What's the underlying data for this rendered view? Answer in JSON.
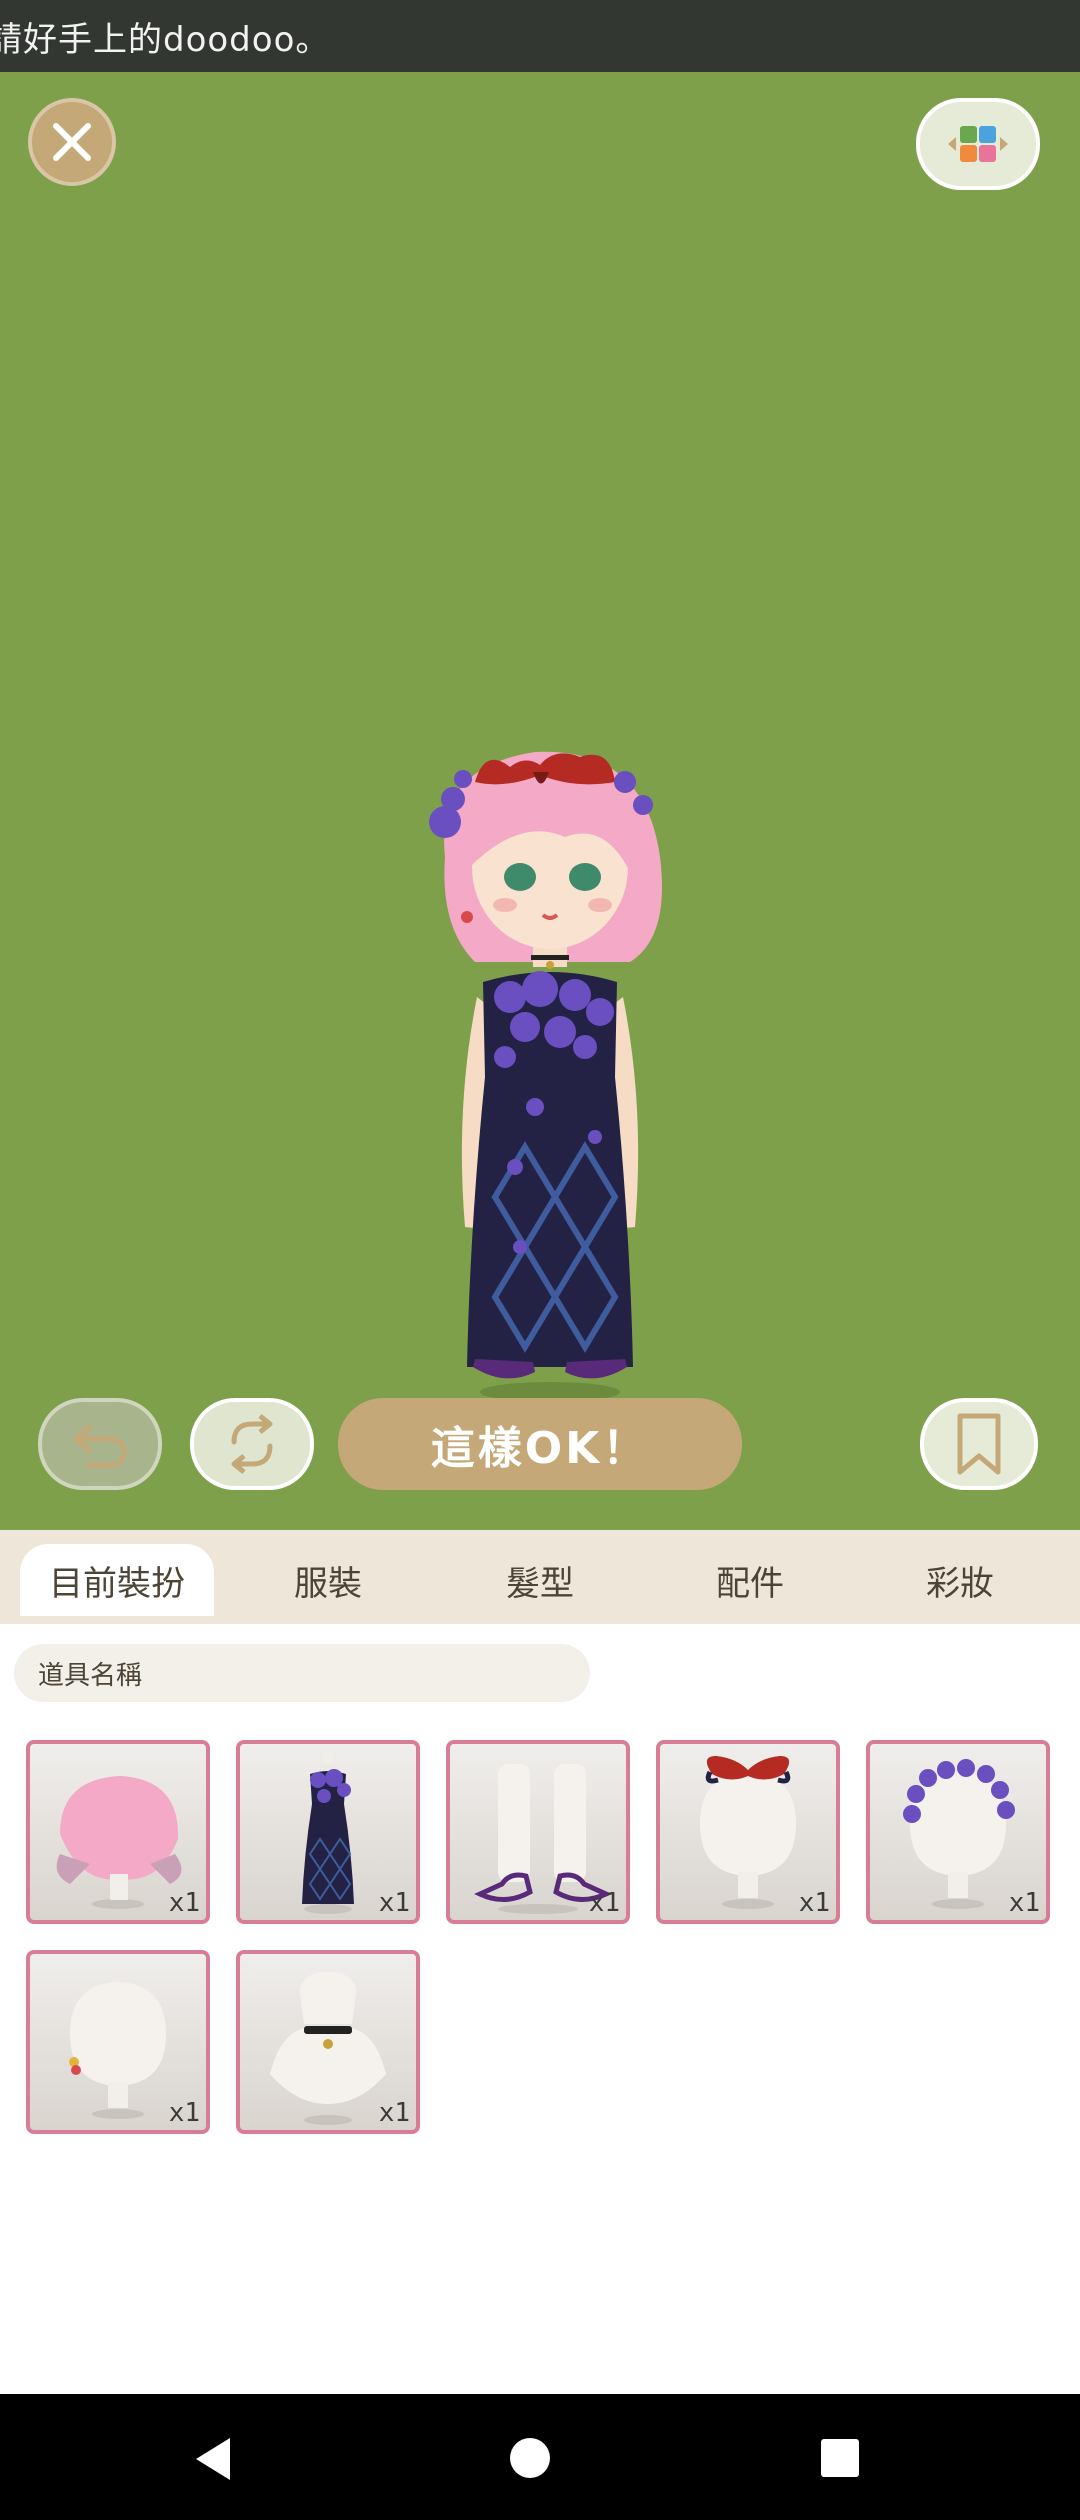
{
  "banner": {
    "text": "請好手上的doodoo。"
  },
  "stage": {
    "close_icon": "close-icon",
    "palette_icon": "color-grid-icon",
    "undo_icon": "undo-icon",
    "refresh_icon": "refresh-icon",
    "ok_label": "這樣OK！",
    "bookmark_icon": "bookmark-icon"
  },
  "tabs": [
    {
      "label": "目前裝扮",
      "active": true
    },
    {
      "label": "服裝",
      "active": false
    },
    {
      "label": "髮型",
      "active": false
    },
    {
      "label": "配件",
      "active": false
    },
    {
      "label": "彩妝",
      "active": false
    }
  ],
  "search": {
    "placeholder": "道具名稱"
  },
  "items": [
    {
      "name": "pink-hair",
      "qty": "x1"
    },
    {
      "name": "violet-dress",
      "qty": "x1"
    },
    {
      "name": "purple-sandals",
      "qty": "x1"
    },
    {
      "name": "red-bow",
      "qty": "x1"
    },
    {
      "name": "violet-wreath",
      "qty": "x1"
    },
    {
      "name": "earring",
      "qty": "x1"
    },
    {
      "name": "choker",
      "qty": "x1"
    }
  ],
  "system_nav": {
    "back_icon": "back-icon",
    "home_icon": "home-icon",
    "recents_icon": "recents-icon"
  },
  "colors": {
    "stage": "#7ea04b",
    "accent": "#c5a877",
    "tab_bar": "#eee6d9",
    "item_border": "#d77d95"
  }
}
